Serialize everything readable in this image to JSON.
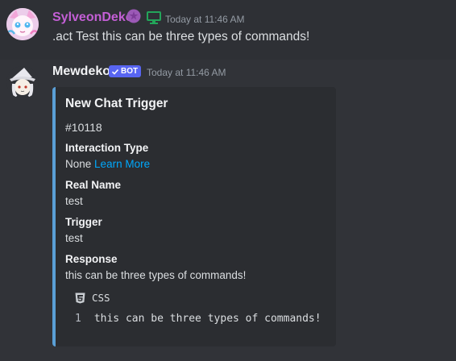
{
  "messages": [
    {
      "author": "SylveonDeko",
      "author_color": "#c45fd6",
      "timestamp": "Today at 11:46 AM",
      "content": ".act Test this can be three types of commands!",
      "icons": [
        "role-icon",
        "desktop-icon"
      ]
    },
    {
      "author": "Mewdeko",
      "badge": "BOT",
      "timestamp": "Today at 11:46 AM",
      "embed": {
        "accent_color": "#5a9fd6",
        "title": "New Chat Trigger",
        "description": "#10118",
        "fields": [
          {
            "name": "Interaction Type",
            "value": "None",
            "link": "Learn More"
          },
          {
            "name": "Real Name",
            "value": "test"
          },
          {
            "name": "Trigger",
            "value": "test"
          },
          {
            "name": "Response",
            "value": "this can be three types of commands!"
          }
        ],
        "code": {
          "language": "CSS",
          "line_number": "1",
          "line": "this can be three types of commands!"
        }
      }
    }
  ]
}
